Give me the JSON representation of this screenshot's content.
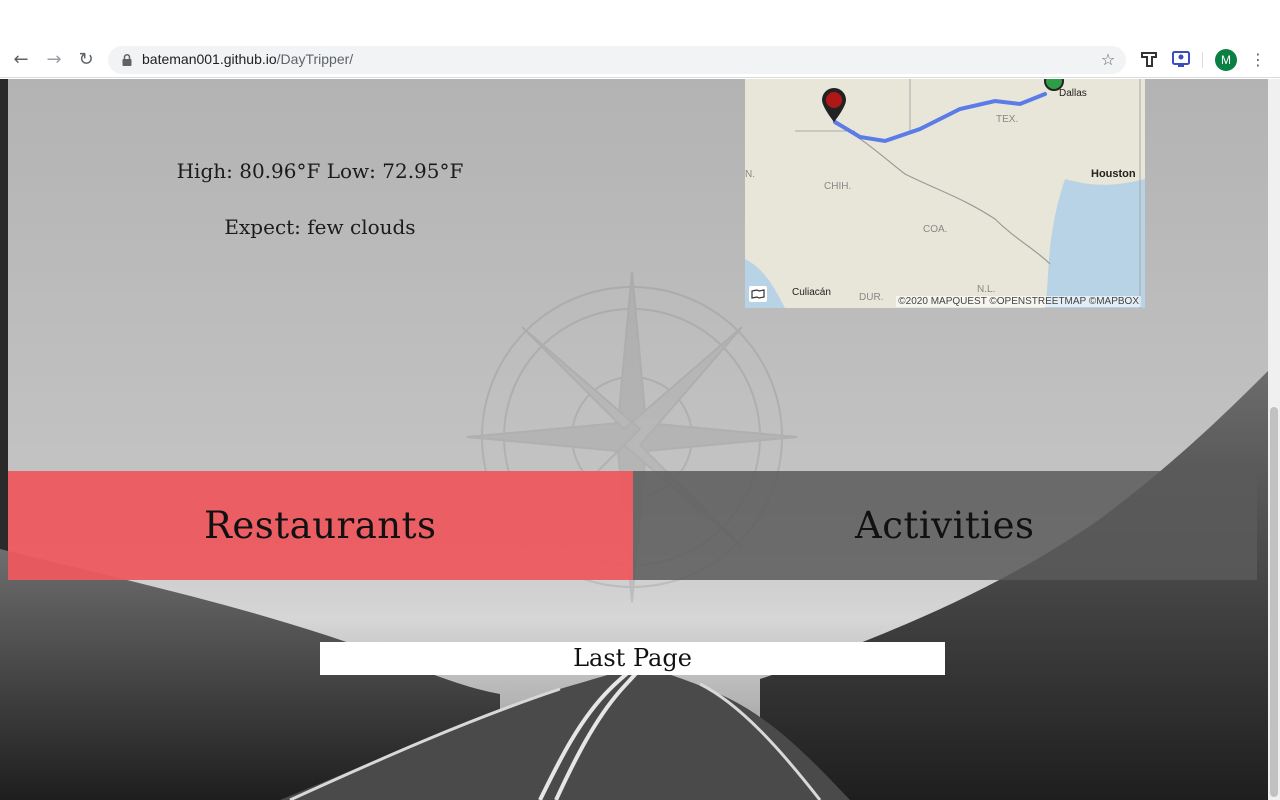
{
  "browser": {
    "url_host": "bateman001.github.io",
    "url_path": "/DayTripper/",
    "avatar_initial": "M"
  },
  "weather": {
    "high_low": "High: 80.96°F Low: 72.95°F",
    "expect": "Expect: few clouds"
  },
  "map": {
    "labels": {
      "dallas": "Dallas",
      "houston": "Houston",
      "tex": "TEX.",
      "chih": "CHIH.",
      "coa": "COA.",
      "culiacan": "Culiacán",
      "dur": "DUR.",
      "nl": "N.L.",
      "n": "N."
    },
    "attribution": "©2020 MAPQUEST ©OPENSTREETMAP ©MAPBOX"
  },
  "categories": {
    "restaurants": "Restaurants",
    "activities": "Activities"
  },
  "navigation": {
    "last_page": "Last Page"
  },
  "colors": {
    "restaurants_tile": "#ec585f",
    "activities_tile": "#5a5a5a",
    "route": "#5b7ce8"
  }
}
